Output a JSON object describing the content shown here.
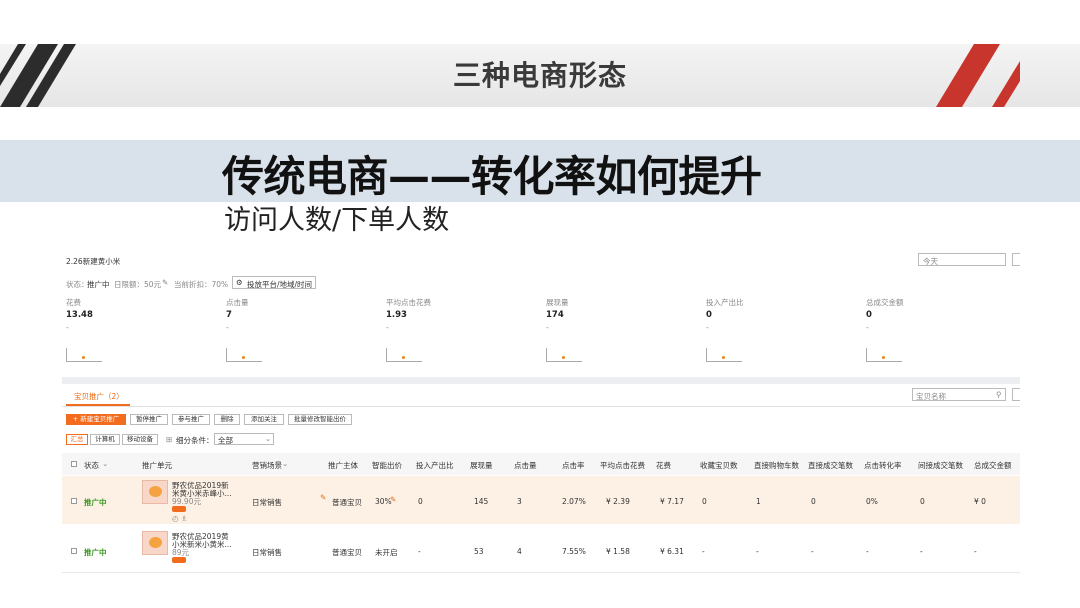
{
  "slide": {
    "header_title": "三种电商形态",
    "main_title": "传统电商——转化率如何提升",
    "subtitle": "访问人数/下单人数"
  },
  "colors": {
    "accent_red": "#c8352c",
    "accent_orange": "#f36b1c",
    "band_blue": "#d9e2ea"
  },
  "shot": {
    "plan_name": "2.26新建黄小米",
    "date_input": "今天",
    "status_line": {
      "status_label": "状态：",
      "status_value": "推广中",
      "budget": "日限额：50元",
      "discount": "当前折扣：70%",
      "platform_button": "投放平台/地域/时间"
    },
    "metrics": [
      {
        "label": "花费",
        "value": "13.48",
        "sub": "-"
      },
      {
        "label": "点击量",
        "value": "7",
        "sub": "-"
      },
      {
        "label": "平均点击花费",
        "value": "1.93",
        "sub": "-"
      },
      {
        "label": "展现量",
        "value": "174",
        "sub": "-"
      },
      {
        "label": "投入产出比",
        "value": "0",
        "sub": "-"
      },
      {
        "label": "总成交金额",
        "value": "0",
        "sub": "-"
      }
    ],
    "tab_label": "宝贝推广（2）",
    "search_placeholder": "宝贝名称",
    "toolbar": {
      "new": "新建宝贝推广",
      "pause": "暂停推广",
      "join": "参与推广",
      "delete": "删除",
      "follow": "添加关注",
      "batch": "批量修改智能出价"
    },
    "device_tabs": [
      "汇总",
      "计算机",
      "移动设备"
    ],
    "filter_label": "细分条件：",
    "filter_value": "全部",
    "columns": [
      "状态",
      "推广单元",
      "营销场景",
      "推广主体",
      "智能出价",
      "投入产出比",
      "展现量",
      "点击量",
      "点击率",
      "平均点击花费",
      "花费",
      "收藏宝贝数",
      "直接购物车数",
      "直接成交笔数",
      "点击转化率",
      "间接成交笔数",
      "总成交金额"
    ],
    "rows": [
      {
        "status": "推广中",
        "unit_line1": "野农优品2019新",
        "unit_line2": "米黄小米赤峰小...",
        "price": "99.90元",
        "scene": "日常销售",
        "subject": "普通宝贝",
        "bid": "30%",
        "roi": "0",
        "impressions": "145",
        "clicks": "3",
        "ctr": "2.07%",
        "cpc": "¥ 2.39",
        "cost": "¥ 7.17",
        "fav": "0",
        "cart": "1",
        "orders": "0",
        "cvr": "0%",
        "indirect": "0",
        "total": "¥ 0"
      },
      {
        "status": "推广中",
        "unit_line1": "野农优品2019黄",
        "unit_line2": "小米新米小黄米...",
        "price": "89元",
        "scene": "日常销售",
        "subject": "普通宝贝",
        "bid": "未开启",
        "roi": "-",
        "impressions": "53",
        "clicks": "4",
        "ctr": "7.55%",
        "cpc": "¥ 1.58",
        "cost": "¥ 6.31",
        "fav": "-",
        "cart": "-",
        "orders": "-",
        "cvr": "-",
        "indirect": "-",
        "total": "-"
      }
    ]
  }
}
